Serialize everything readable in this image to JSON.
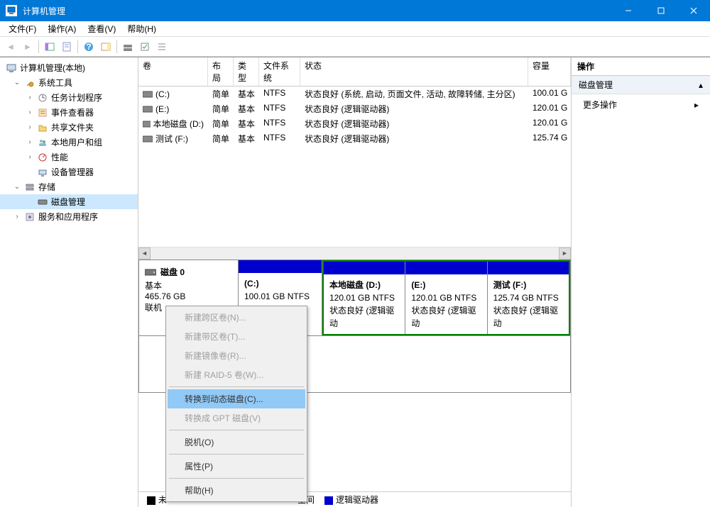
{
  "titlebar": {
    "title": "计算机管理"
  },
  "menu": {
    "file": "文件(F)",
    "action": "操作(A)",
    "view": "查看(V)",
    "help": "帮助(H)"
  },
  "tree": {
    "root": "计算机管理(本地)",
    "system_tools": "系统工具",
    "task_scheduler": "任务计划程序",
    "event_viewer": "事件查看器",
    "shared_folders": "共享文件夹",
    "local_users": "本地用户和组",
    "performance": "性能",
    "device_manager": "设备管理器",
    "storage": "存储",
    "disk_management": "磁盘管理",
    "services": "服务和应用程序"
  },
  "vol_cols": {
    "volume": "卷",
    "layout": "布局",
    "type": "类型",
    "fs": "文件系统",
    "status": "状态",
    "capacity": "容量"
  },
  "volumes": [
    {
      "name": "(C:)",
      "layout": "简单",
      "type": "基本",
      "fs": "NTFS",
      "status": "状态良好 (系统, 启动, 页面文件, 活动, 故障转储, 主分区)",
      "capacity": "100.01 G"
    },
    {
      "name": "(E:)",
      "layout": "简单",
      "type": "基本",
      "fs": "NTFS",
      "status": "状态良好 (逻辑驱动器)",
      "capacity": "120.01 G"
    },
    {
      "name": "本地磁盘 (D:)",
      "layout": "简单",
      "type": "基本",
      "fs": "NTFS",
      "status": "状态良好 (逻辑驱动器)",
      "capacity": "120.01 G"
    },
    {
      "name": "测试 (F:)",
      "layout": "简单",
      "type": "基本",
      "fs": "NTFS",
      "status": "状态良好 (逻辑驱动器)",
      "capacity": "125.74 G"
    }
  ],
  "disk": {
    "label": "磁盘 0",
    "type": "基本",
    "size": "465.76 GB",
    "status": "联机"
  },
  "parts": [
    {
      "title": "(C:)",
      "line1": "100.01 GB NTFS",
      "line2": ""
    },
    {
      "title": "本地磁盘  (D:)",
      "line1": "120.01 GB NTFS",
      "line2": "状态良好 (逻辑驱动"
    },
    {
      "title": "(E:)",
      "line1": "120.01 GB NTFS",
      "line2": "状态良好 (逻辑驱动"
    },
    {
      "title": "测试  (F:)",
      "line1": "125.74 GB NTFS",
      "line2": "状态良好 (逻辑驱动"
    }
  ],
  "legend": {
    "unalloc": "未",
    "unalloc_label": "空间",
    "primary": "",
    "logical": "逻辑驱动器"
  },
  "actions": {
    "header": "操作",
    "section": "磁盘管理",
    "more": "更多操作"
  },
  "ctx": {
    "span": "新建跨区卷(N)...",
    "stripe": "新建带区卷(T)...",
    "mirror": "新建镜像卷(R)...",
    "raid5": "新建 RAID-5 卷(W)...",
    "to_dynamic": "转换到动态磁盘(C)...",
    "to_gpt": "转换成 GPT 磁盘(V)",
    "offline": "脱机(O)",
    "props": "属性(P)",
    "help": "帮助(H)"
  },
  "colors": {
    "partition_header": "#0000ce",
    "selection_border": "#008000",
    "highlight": "#91c9f7",
    "titlebar": "#0078d7",
    "unalloc": "#000000",
    "primary_sw": "#0000ce"
  }
}
